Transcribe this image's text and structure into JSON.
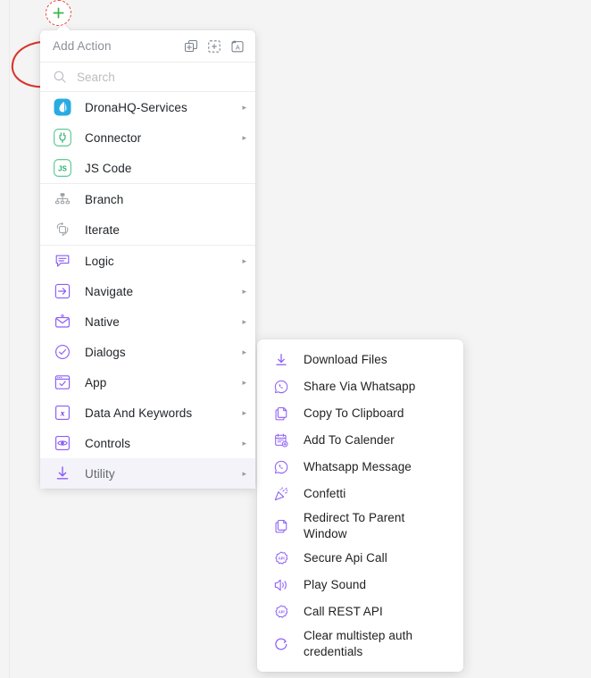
{
  "canvas": {
    "background_color": "#f4f4f4",
    "add_node": {
      "icon": "plus-icon",
      "tooltip": "Add"
    }
  },
  "annotations": [
    {
      "name": "red-circle-annotation",
      "color": "#d9342b",
      "shape": "circle"
    },
    {
      "name": "red-underline-annotation",
      "color": "#d9342b",
      "shape": "underline",
      "target": "Whatsapp Message"
    }
  ],
  "menu": {
    "title": "Add Action",
    "header_icons": [
      {
        "name": "duplicate-add-icon",
        "label": "Duplicate"
      },
      {
        "name": "dashed-box-add-icon",
        "label": "Add Group"
      },
      {
        "name": "annotate-text-icon",
        "label": "Annotate"
      }
    ],
    "search": {
      "placeholder": "Search",
      "value": "",
      "icon": "search-icon"
    },
    "groups": [
      {
        "items": [
          {
            "label": "DronaHQ-Services",
            "icon": "dronahq-icon",
            "has_submenu": true,
            "selected": false
          },
          {
            "label": "Connector",
            "icon": "connector-plug-icon",
            "has_submenu": true,
            "selected": false
          },
          {
            "label": "JS Code",
            "icon": "js-code-icon",
            "has_submenu": false,
            "selected": false
          }
        ]
      },
      {
        "items": [
          {
            "label": "Branch",
            "icon": "branch-icon",
            "has_submenu": false,
            "selected": false
          },
          {
            "label": "Iterate",
            "icon": "iterate-icon",
            "has_submenu": false,
            "selected": false
          }
        ]
      },
      {
        "items": [
          {
            "label": "Logic",
            "icon": "logic-icon",
            "has_submenu": true,
            "selected": false
          },
          {
            "label": "Navigate",
            "icon": "navigate-arrow-icon",
            "has_submenu": true,
            "selected": false
          },
          {
            "label": "Native",
            "icon": "native-mail-icon",
            "has_submenu": true,
            "selected": false
          },
          {
            "label": "Dialogs",
            "icon": "dialogs-check-icon",
            "has_submenu": true,
            "selected": false
          },
          {
            "label": "App",
            "icon": "app-window-icon",
            "has_submenu": true,
            "selected": false
          },
          {
            "label": "Data And Keywords",
            "icon": "data-keywords-x-icon",
            "has_submenu": true,
            "selected": false
          },
          {
            "label": "Controls",
            "icon": "controls-eye-icon",
            "has_submenu": true,
            "selected": false
          },
          {
            "label": "Utility",
            "icon": "utility-download-icon",
            "has_submenu": true,
            "selected": true
          }
        ]
      }
    ]
  },
  "submenu": {
    "parent": "Utility",
    "items": [
      {
        "label": "Download Files",
        "icon": "download-icon",
        "highlighted": false
      },
      {
        "label": "Share Via Whatsapp",
        "icon": "whatsapp-icon",
        "highlighted": false
      },
      {
        "label": "Copy To Clipboard",
        "icon": "copy-icon",
        "highlighted": false
      },
      {
        "label": "Add To Calender",
        "icon": "calendar-add-icon",
        "highlighted": false
      },
      {
        "label": "Whatsapp Message",
        "icon": "whatsapp-icon",
        "highlighted": true
      },
      {
        "label": "Confetti",
        "icon": "confetti-icon",
        "highlighted": false
      },
      {
        "label": "Redirect To Parent Window",
        "icon": "copy-icon",
        "highlighted": false
      },
      {
        "label": "Secure Api Call",
        "icon": "secure-api-icon",
        "highlighted": false
      },
      {
        "label": "Play Sound",
        "icon": "speaker-icon",
        "highlighted": false
      },
      {
        "label": "Call REST API",
        "icon": "rest-api-icon",
        "highlighted": false
      },
      {
        "label": "Clear multistep auth credentials",
        "icon": "refresh-icon",
        "highlighted": false
      }
    ]
  },
  "colors": {
    "accent_purple": "#8b5cf6",
    "annotation_red": "#d9342b",
    "plus_green": "#3cb44a",
    "dronahq_blue": "#29abe2",
    "connector_green": "#3cb878",
    "selected_bg": "#f4f3f9"
  }
}
